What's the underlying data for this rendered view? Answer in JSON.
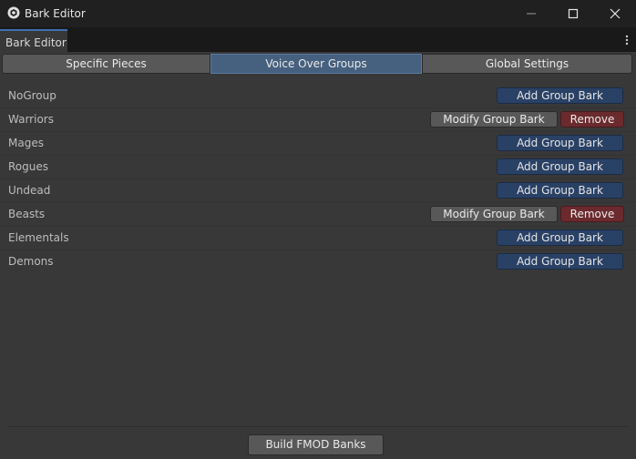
{
  "window": {
    "title": "Bark Editor",
    "icon": "unity-cube-icon"
  },
  "window_controls": {
    "minimize": "minimize-icon",
    "maximize": "maximize-icon",
    "close": "close-icon"
  },
  "editor_tab": {
    "label": "Bark Editor",
    "menu_icon": "more-vertical-icon"
  },
  "tabs": [
    {
      "label": "Specific Pieces",
      "active": false
    },
    {
      "label": "Voice Over Groups",
      "active": true
    },
    {
      "label": "Global Settings",
      "active": false
    }
  ],
  "groups": [
    {
      "name": "NoGroup",
      "actions": [
        "Add Group Bark"
      ]
    },
    {
      "name": "Warriors",
      "actions": [
        "Modify Group Bark",
        "Remove"
      ]
    },
    {
      "name": "Mages",
      "actions": [
        "Add Group Bark"
      ]
    },
    {
      "name": "Rogues",
      "actions": [
        "Add Group Bark"
      ]
    },
    {
      "name": "Undead",
      "actions": [
        "Add Group Bark"
      ]
    },
    {
      "name": "Beasts",
      "actions": [
        "Modify Group Bark",
        "Remove"
      ]
    },
    {
      "name": "Elementals",
      "actions": [
        "Add Group Bark"
      ]
    },
    {
      "name": "Demons",
      "actions": [
        "Add Group Bark"
      ]
    }
  ],
  "footer": {
    "build_label": "Build FMOD Banks"
  },
  "colors": {
    "background": "#383838",
    "add_button": "#2a4166",
    "remove_button": "#6b2a2e",
    "active_tab": "#46607f"
  }
}
